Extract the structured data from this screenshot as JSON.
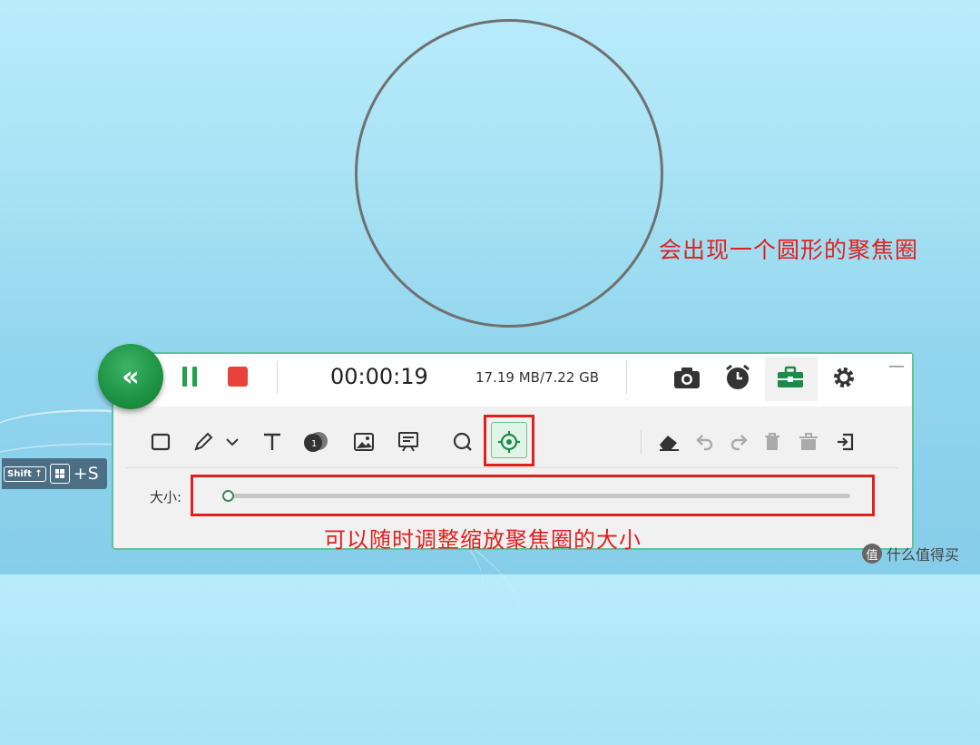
{
  "annotations": {
    "circle_appears": "会出现一个圆形的聚焦圈",
    "adjust_size": "可以随时调整缩放聚焦圈的大小"
  },
  "shortcut": {
    "shift_key": "Shift ↑",
    "plus_key": "+S"
  },
  "toolbar": {
    "collapse_icon": "«",
    "timer": "00:00:19",
    "file_size": "17.19 MB/7.22 GB",
    "minimize": "—",
    "size_label": "大小:",
    "focus_size_fraction": 0.0
  },
  "icons": {
    "top": [
      "camera-icon",
      "alarm-clock-icon",
      "toolbox-icon",
      "gear-icon"
    ],
    "tools": [
      "rectangle-icon",
      "pen-icon",
      "chevron-down-icon",
      "text-icon",
      "number-marker-icon",
      "image-icon",
      "whiteboard-icon",
      "magnifier-icon",
      "spotlight-icon"
    ],
    "actions": [
      "eraser-icon",
      "undo-icon",
      "redo-icon",
      "delete-icon",
      "clear-all-icon",
      "exit-icon"
    ]
  },
  "colors": {
    "accent_green": "#22a049",
    "record_red": "#e8423a",
    "annotation_red": "#e0201d"
  },
  "watermark": {
    "badge": "值",
    "text": "什么值得买"
  }
}
